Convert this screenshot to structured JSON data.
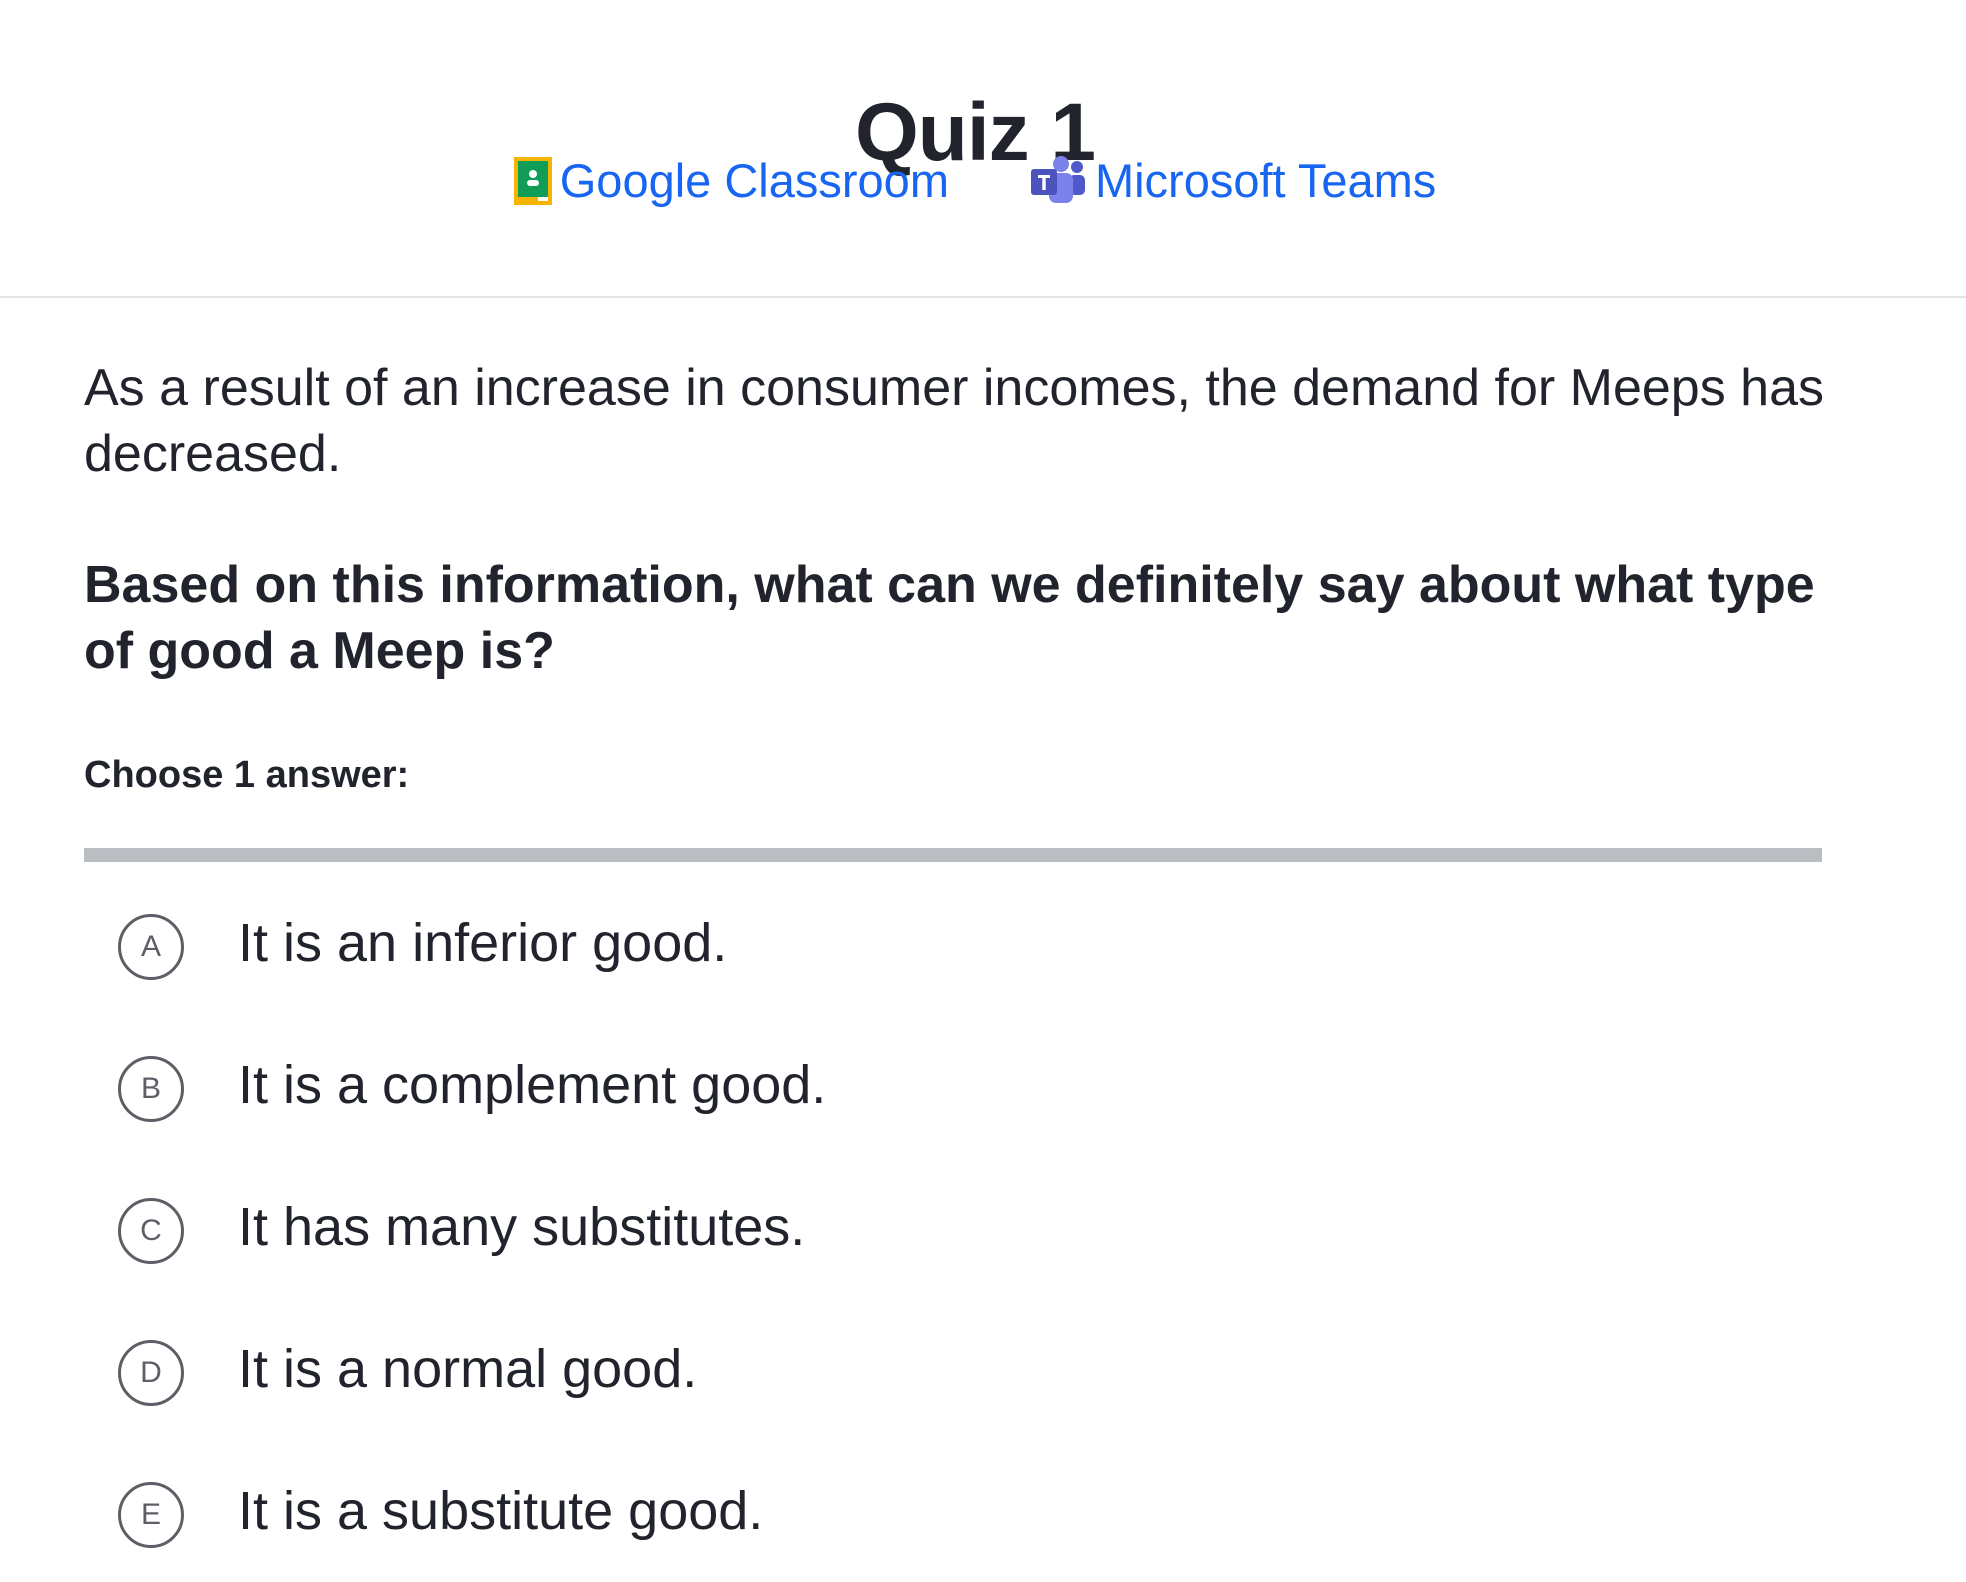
{
  "header": {
    "title": "Quiz 1",
    "share_links": [
      {
        "label": "Google Classroom",
        "icon": "google-classroom-icon"
      },
      {
        "label": "Microsoft Teams",
        "icon": "microsoft-teams-icon"
      }
    ]
  },
  "question": {
    "stem": "As a result of an increase in consumer incomes, the demand for Meeps has decreased.",
    "prompt": "Based on this information, what can we definitely say about what type of good a Meep is?",
    "instruction": "Choose 1 answer:"
  },
  "choices": [
    {
      "letter": "A",
      "text": "It is an inferior good."
    },
    {
      "letter": "B",
      "text": "It is a complement good."
    },
    {
      "letter": "C",
      "text": "It has many substitutes."
    },
    {
      "letter": "D",
      "text": "It is a normal good."
    },
    {
      "letter": "E",
      "text": "It is a substitute good."
    }
  ],
  "colors": {
    "link": "#1865f2",
    "text": "#21242c",
    "choice_border": "#5c5f66",
    "divider": "#babec2",
    "google_classroom_green": "#0f9d58",
    "google_classroom_yellow": "#f4b400",
    "teams_purple": "#5059c9"
  }
}
